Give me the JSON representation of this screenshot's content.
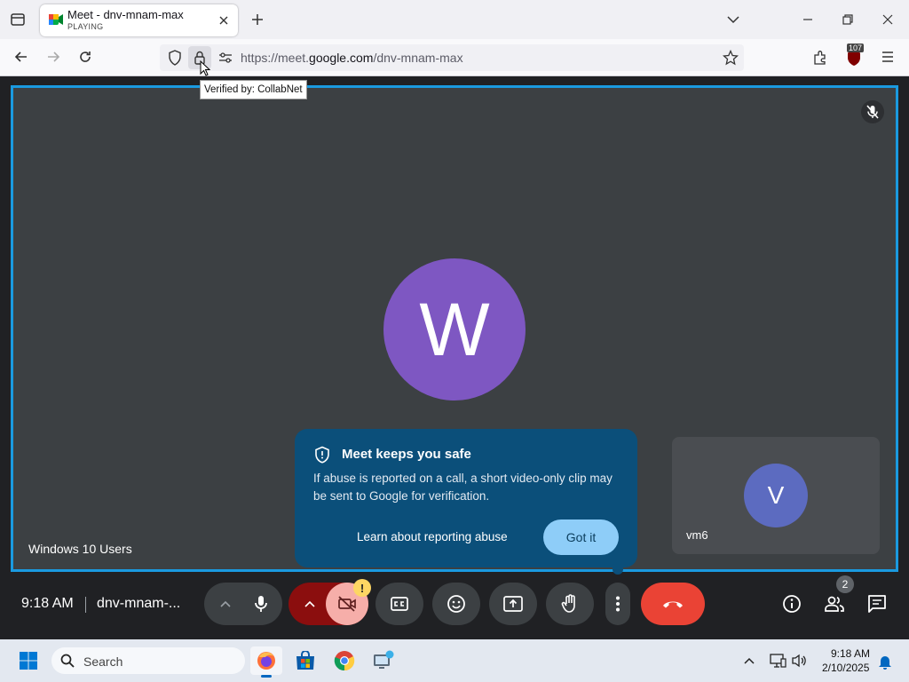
{
  "browser": {
    "tab": {
      "title": "Meet - dnv-mnam-max",
      "status": "PLAYING"
    },
    "url_prefix": "https://meet.",
    "url_domain": "google.com",
    "url_path": "/dnv-mnam-max",
    "tooltip": "Verified by: CollabNet",
    "extension_badge": "107"
  },
  "meet": {
    "main_participant": {
      "initial": "W",
      "name": "Windows 10 Users",
      "avatar_color": "#7e57c2"
    },
    "self_tile": {
      "initial": "V",
      "name": "vm6",
      "avatar_color": "#5c6bc0"
    },
    "popup": {
      "title": "Meet keeps you safe",
      "body": "If abuse is reported on a call, a short video-only clip may be sent to Google for verification.",
      "link": "Learn about reporting abuse",
      "button": "Got it"
    },
    "controls": {
      "time": "9:18 AM",
      "meeting_code": "dnv-mnam-...",
      "camera_warning": "!",
      "participants_count": "2"
    },
    "colors": {
      "stage_border": "#1a9ae0",
      "end_call": "#ea4335",
      "popup_bg": "#0b4f7a"
    }
  },
  "taskbar": {
    "search_placeholder": "Search",
    "time": "9:18 AM",
    "date": "2/10/2025"
  }
}
